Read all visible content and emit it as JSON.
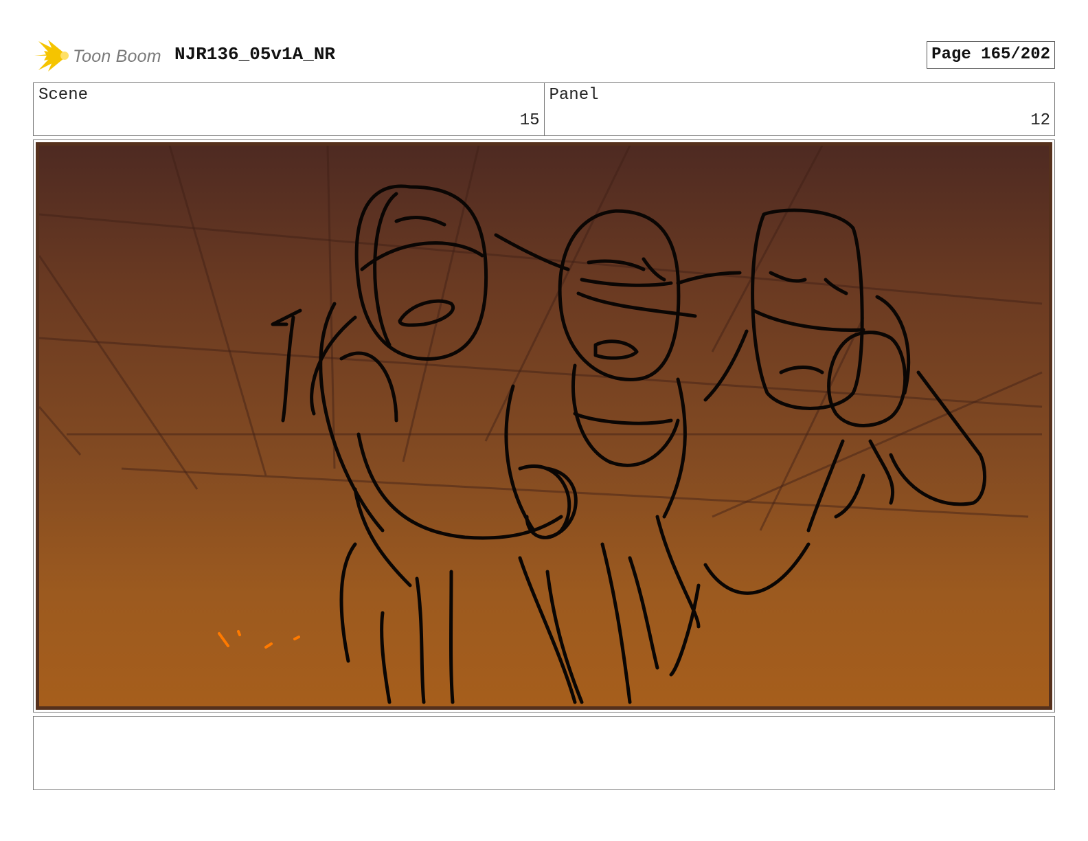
{
  "header": {
    "logo_text": "Toon Boom",
    "doc_title": "NJR136_05v1A_NR",
    "page_label": "Page 165/202"
  },
  "info": {
    "scene_label": "Scene",
    "scene_value": "15",
    "panel_label": "Panel",
    "panel_value": "12"
  },
  "colors": {
    "logo_accent": "#f5c400",
    "panel_border": "#55301c",
    "sky_top": "#4e2a22",
    "sky_bottom": "#a65e1c",
    "sketch_ink": "#0a0604",
    "spark": "#ff7a00"
  },
  "panel_image": {
    "icon": "storyboard-sketch"
  }
}
